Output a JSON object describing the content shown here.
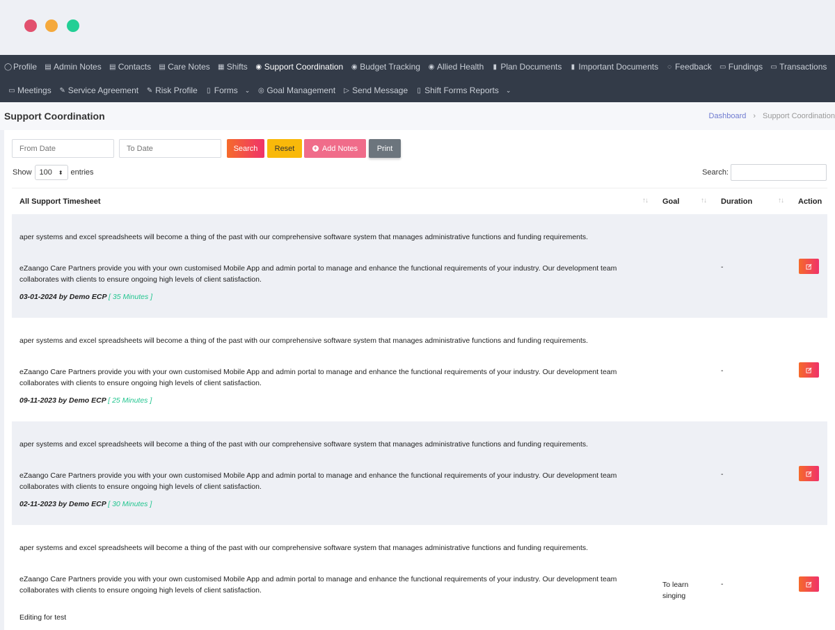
{
  "window": {
    "controls": [
      "close",
      "minimize",
      "maximize"
    ]
  },
  "nav": {
    "row1": [
      {
        "label": "Profile",
        "icon": "user-icon"
      },
      {
        "label": "Admin Notes",
        "icon": "note-icon"
      },
      {
        "label": "Contacts",
        "icon": "contacts-icon"
      },
      {
        "label": "Care Notes",
        "icon": "note-icon"
      },
      {
        "label": "Shifts",
        "icon": "calendar-icon"
      },
      {
        "label": "Support Coordination",
        "icon": "users-icon",
        "active": true
      },
      {
        "label": "Budget Tracking",
        "icon": "users-icon"
      },
      {
        "label": "Allied Health",
        "icon": "users-icon"
      },
      {
        "label": "Plan Documents",
        "icon": "document-icon"
      },
      {
        "label": "Important Documents",
        "icon": "document-icon"
      },
      {
        "label": "Feedback",
        "icon": "chat-icon"
      },
      {
        "label": "Fundings",
        "icon": "wallet-icon"
      },
      {
        "label": "Transactions",
        "icon": "card-icon"
      }
    ],
    "row2": [
      {
        "label": "Meetings",
        "icon": "monitor-icon"
      },
      {
        "label": "Service Agreement",
        "icon": "edit-icon"
      },
      {
        "label": "Risk Profile",
        "icon": "edit-icon"
      },
      {
        "label": "Forms",
        "icon": "file-icon",
        "dropdown": true
      },
      {
        "label": "Goal Management",
        "icon": "target-icon"
      },
      {
        "label": "Send Message",
        "icon": "send-icon"
      },
      {
        "label": "Shift Forms Reports",
        "icon": "file-icon",
        "dropdown": true
      }
    ]
  },
  "header": {
    "title": "Support Coordination",
    "breadcrumb": {
      "home": "Dashboard",
      "separator": "›",
      "current": "Support Coordination"
    }
  },
  "filters": {
    "from_placeholder": "From Date",
    "to_placeholder": "To Date",
    "search_label": "Search",
    "reset_label": "Reset",
    "add_notes_label": "Add Notes",
    "print_label": "Print"
  },
  "table_controls": {
    "show_label": "Show",
    "entries_value": "100",
    "entries_label": "entries",
    "search_label": "Search:"
  },
  "table": {
    "columns": [
      "All Support Timesheet",
      "Goal",
      "Duration",
      "Action"
    ],
    "rows": [
      {
        "p1": "aper systems and excel spreadsheets will become a thing of the past with our comprehensive software system that manages administrative functions and funding requirements.",
        "p2": "eZaango Care Partners provide you with your own customised Mobile App and admin portal to manage and enhance the functional requirements of your industry. Our development team collaborates with clients to ensure ongoing high levels of client satisfaction.",
        "meta": "03-01-2024 by Demo ECP",
        "minutes": "[ 35 Minutes ]",
        "goal": "",
        "duration": "-"
      },
      {
        "p1": "aper systems and excel spreadsheets will become a thing of the past with our comprehensive software system that manages administrative functions and funding requirements.",
        "p2": "eZaango Care Partners provide you with your own customised Mobile App and admin portal to manage and enhance the functional requirements of your industry. Our development team collaborates with clients to ensure ongoing high levels of client satisfaction.",
        "meta": "09-11-2023 by Demo ECP",
        "minutes": "[ 25 Minutes ]",
        "goal": "",
        "duration": "-"
      },
      {
        "p1": "aper systems and excel spreadsheets will become a thing of the past with our comprehensive software system that manages administrative functions and funding requirements.",
        "p2": "eZaango Care Partners provide you with your own customised Mobile App and admin portal to manage and enhance the functional requirements of your industry. Our development team collaborates with clients to ensure ongoing high levels of client satisfaction.",
        "meta": "02-11-2023 by Demo ECP",
        "minutes": "[ 30 Minutes ]",
        "goal": "",
        "duration": "-"
      },
      {
        "p1": "aper systems and excel spreadsheets will become a thing of the past with our comprehensive software system that manages administrative functions and funding requirements.",
        "p2": "eZaango Care Partners provide you with your own customised Mobile App and admin portal to manage and enhance the functional requirements of your industry. Our development team collaborates with clients to ensure ongoing high levels of client satisfaction.",
        "extra": "Editing for test",
        "goal": "To learn singing",
        "duration": "-"
      }
    ]
  },
  "colors": {
    "nav_bg": "#333b48",
    "accent_gradient_start": "#f56b2b",
    "accent_gradient_end": "#f0326a",
    "duration_green": "#22c58f",
    "reset_yellow": "#f9b90a",
    "add_pink": "#f06c8a",
    "print_gray": "#6c757d"
  }
}
